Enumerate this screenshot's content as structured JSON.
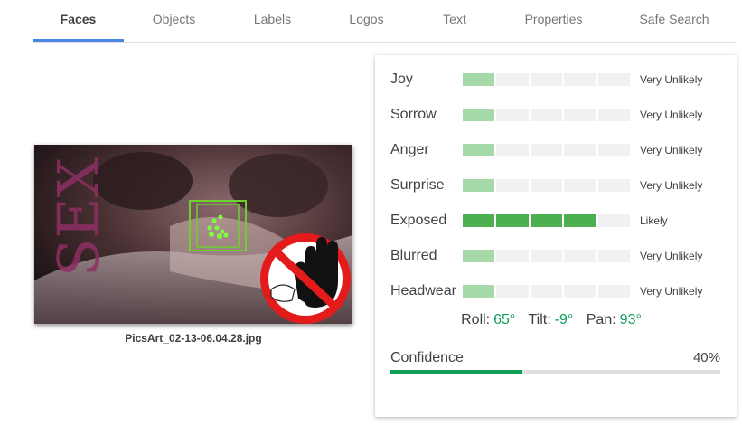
{
  "tabs": [
    {
      "label": "Faces",
      "active": true
    },
    {
      "label": "Objects"
    },
    {
      "label": "Labels"
    },
    {
      "label": "Logos"
    },
    {
      "label": "Text"
    },
    {
      "label": "Properties"
    },
    {
      "label": "Safe Search"
    }
  ],
  "image": {
    "filename": "PicsArt_02-13-06.04.28.jpg",
    "overlay_text": "SEX"
  },
  "attributes": [
    {
      "label": "Joy",
      "level": 1,
      "value": "Very Unlikely"
    },
    {
      "label": "Sorrow",
      "level": 1,
      "value": "Very Unlikely"
    },
    {
      "label": "Anger",
      "level": 1,
      "value": "Very Unlikely"
    },
    {
      "label": "Surprise",
      "level": 1,
      "value": "Very Unlikely"
    },
    {
      "label": "Exposed",
      "level": 4,
      "value": "Likely"
    },
    {
      "label": "Blurred",
      "level": 1,
      "value": "Very Unlikely"
    },
    {
      "label": "Headwear",
      "level": 1,
      "value": "Very Unlikely"
    }
  ],
  "angles": {
    "roll_label": "Roll:",
    "roll": "65°",
    "tilt_label": "Tilt:",
    "tilt": "-9°",
    "pan_label": "Pan:",
    "pan": "93°"
  },
  "confidence": {
    "label": "Confidence",
    "value": "40%",
    "fraction": 0.4
  },
  "colors": {
    "accent": "#4a86e8",
    "good": "#0f9d58",
    "bar_strong": "#4caf50",
    "bar_light": "#a6d9a8"
  }
}
